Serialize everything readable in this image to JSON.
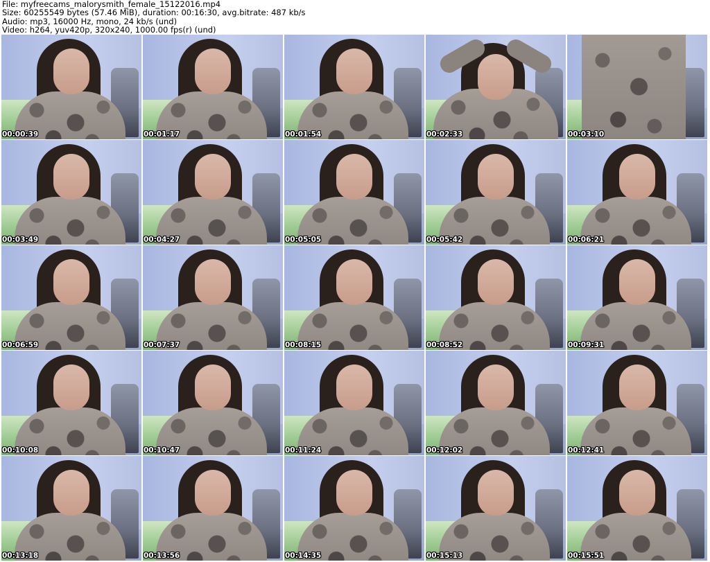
{
  "header": {
    "file_line": "File: myfreecams_malorysmith_female_15122016.mp4",
    "size_line": "Size: 60255549 bytes (57.46 MiB), duration: 00:16:30, avg.bitrate: 487 kb/s",
    "audio_line": "Audio: mp3, 16000 Hz, mono, 24 kb/s (und)",
    "video_line": "Video: h264, yuv420p, 320x240, 1000.00 fps(r) (und)"
  },
  "thumbnails": [
    {
      "timestamp": "00:00:39"
    },
    {
      "timestamp": "00:01:17"
    },
    {
      "timestamp": "00:01:54"
    },
    {
      "timestamp": "00:02:33"
    },
    {
      "timestamp": "00:03:10"
    },
    {
      "timestamp": "00:03:49"
    },
    {
      "timestamp": "00:04:27"
    },
    {
      "timestamp": "00:05:05"
    },
    {
      "timestamp": "00:05:42"
    },
    {
      "timestamp": "00:06:21"
    },
    {
      "timestamp": "00:06:59"
    },
    {
      "timestamp": "00:07:37"
    },
    {
      "timestamp": "00:08:15"
    },
    {
      "timestamp": "00:08:52"
    },
    {
      "timestamp": "00:09:31"
    },
    {
      "timestamp": "00:10:08"
    },
    {
      "timestamp": "00:10:47"
    },
    {
      "timestamp": "00:11:24"
    },
    {
      "timestamp": "00:12:02"
    },
    {
      "timestamp": "00:12:41"
    },
    {
      "timestamp": "00:13:18"
    },
    {
      "timestamp": "00:13:56"
    },
    {
      "timestamp": "00:14:35"
    },
    {
      "timestamp": "00:15:13"
    },
    {
      "timestamp": "00:15:51"
    }
  ],
  "colors": {
    "background": "#ffffff",
    "header_text": "#000000",
    "timestamp_text": "#ffffff",
    "timestamp_outline": "#000000"
  }
}
